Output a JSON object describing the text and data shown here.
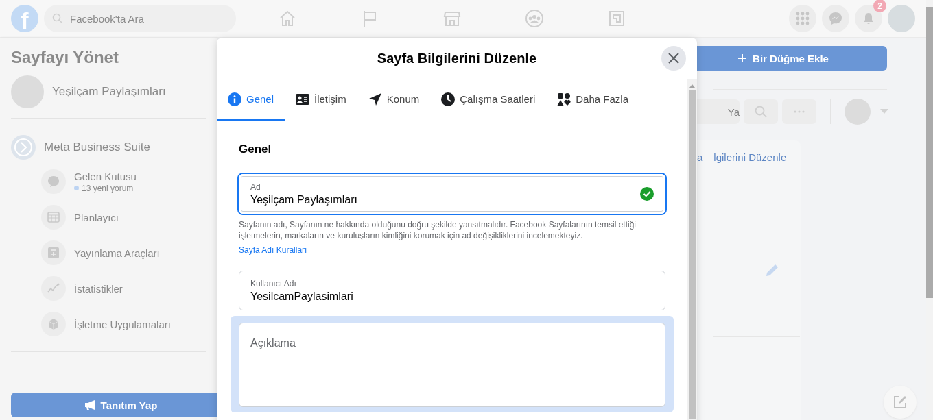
{
  "top_bar": {
    "logo": "f",
    "search": {
      "placeholder": "Facebook'ta Ara"
    },
    "notification_count": "2"
  },
  "sidebar": {
    "title": "Sayfayı Yönet",
    "page_name": "Yeşilçam Paylaşımları",
    "section": "Meta Business Suite",
    "items": [
      {
        "label": "Gelen Kutusu",
        "sub": "13 yeni yorum"
      },
      {
        "label": "Planlayıcı"
      },
      {
        "label": "Yayınlama Araçları"
      },
      {
        "label": "İstatistikler"
      },
      {
        "label": "İşletme Uygulamaları"
      }
    ],
    "promote_button": "Tanıtım Yap"
  },
  "page": {
    "add_button": "Bir Düğme Ekle",
    "search_fragment": "Ya",
    "edit_link_fragments": [
      "a",
      "lgilerini Düzenle"
    ]
  },
  "dialog": {
    "title": "Sayfa Bilgilerini Düzenle",
    "tabs": [
      {
        "label": "Genel",
        "selected": true
      },
      {
        "label": "İletişim",
        "selected": false
      },
      {
        "label": "Konum",
        "selected": false
      },
      {
        "label": "Çalışma Saatleri",
        "selected": false
      },
      {
        "label": "Daha Fazla",
        "selected": false
      }
    ],
    "section_title": "Genel",
    "fields": [
      {
        "kind": "text",
        "label": "Ad",
        "value": "Yeşilçam Paylaşımları",
        "focused": true,
        "valid": true,
        "help": "Sayfanın adı, Sayfanın ne hakkında olduğunu doğru şekilde yansıtmalıdır. Facebook Sayfalarının temsil ettiği işletmelerin, markaların ve kuruluşların kimliğini korumak için ad değişikliklerini incelemekteyiz.",
        "link": "Sayfa Adı Kuralları"
      },
      {
        "kind": "text",
        "label": "Kullanıcı Adı",
        "value": "YesilcamPaylasimlari",
        "focused": false,
        "valid": false
      },
      {
        "kind": "textarea",
        "placeholder": "Açıklama",
        "focused": false,
        "highlighted": true
      }
    ]
  }
}
